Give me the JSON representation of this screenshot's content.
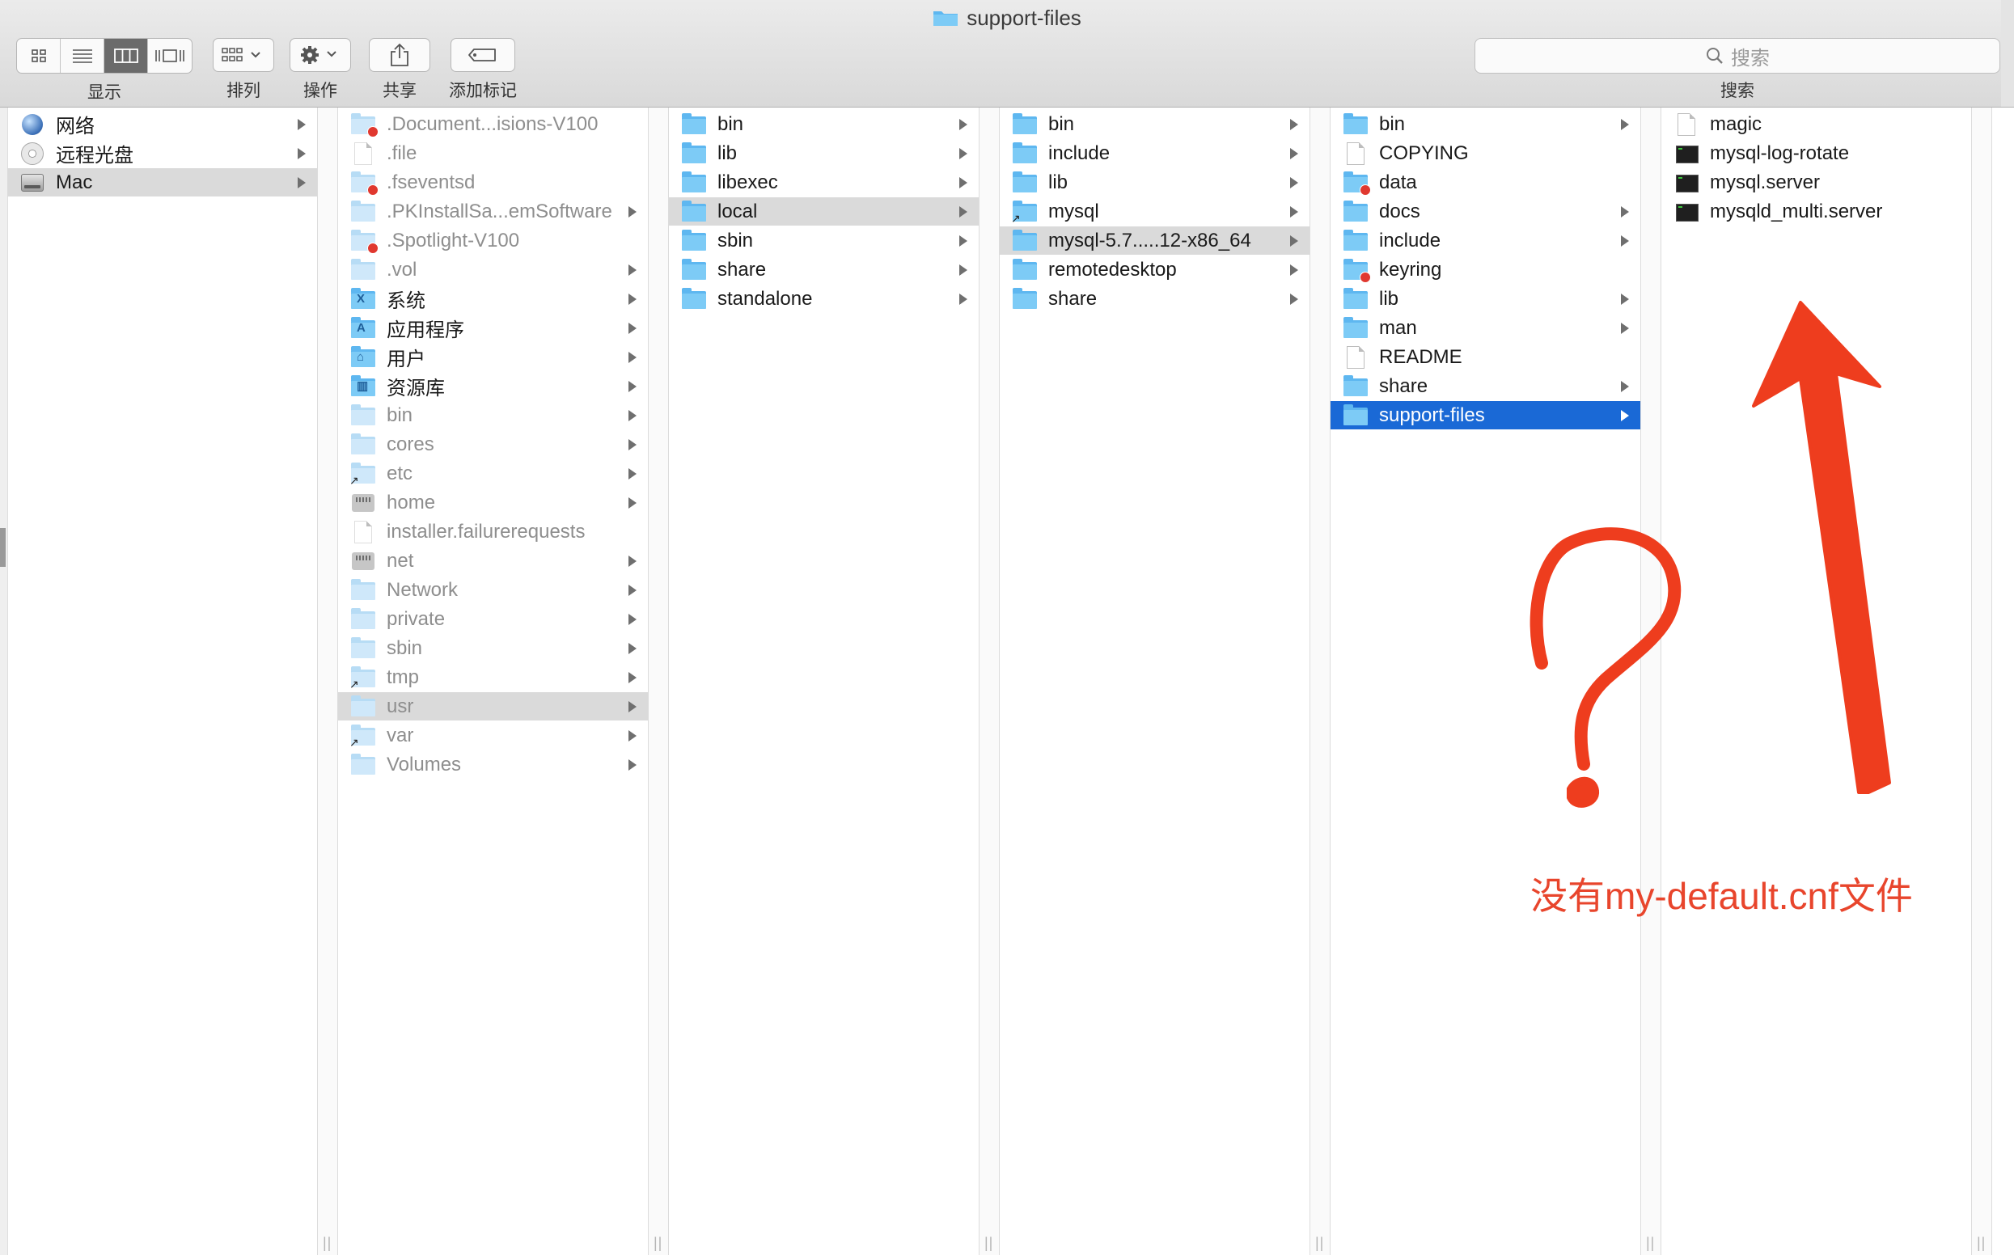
{
  "window": {
    "title": "support-files"
  },
  "toolbar": {
    "view_label": "显示",
    "arrange_label": "排列",
    "action_label": "操作",
    "share_label": "共享",
    "tags_label": "添加标记",
    "search_placeholder": "搜索",
    "search_label": "搜索"
  },
  "columns": [
    {
      "items": [
        {
          "label": "网络",
          "icon": "globe-icon",
          "arrow": true
        },
        {
          "label": "远程光盘",
          "icon": "disc-icon",
          "arrow": true
        },
        {
          "label": "Mac",
          "icon": "hard-drive-icon",
          "arrow": true,
          "state": "path"
        }
      ]
    },
    {
      "items": [
        {
          "label": ".Document...isions-V100",
          "icon": "folder-icon",
          "dim": true,
          "badge": "restricted"
        },
        {
          "label": ".file",
          "icon": "document-icon",
          "dim": true
        },
        {
          "label": ".fseventsd",
          "icon": "folder-icon",
          "dim": true,
          "badge": "restricted"
        },
        {
          "label": ".PKInstallSa...emSoftware",
          "icon": "folder-icon",
          "dim": true,
          "arrow": true
        },
        {
          "label": ".Spotlight-V100",
          "icon": "folder-icon",
          "dim": true,
          "badge": "restricted"
        },
        {
          "label": ".vol",
          "icon": "folder-icon",
          "dim": true,
          "arrow": true
        },
        {
          "label": "系统",
          "icon": "system-folder-icon",
          "arrow": true,
          "glyph": "X"
        },
        {
          "label": "应用程序",
          "icon": "applications-folder-icon",
          "arrow": true,
          "glyph": "A"
        },
        {
          "label": "用户",
          "icon": "users-folder-icon",
          "arrow": true,
          "glyph": "⌂"
        },
        {
          "label": "资源库",
          "icon": "library-folder-icon",
          "arrow": true,
          "glyph": "▥"
        },
        {
          "label": "bin",
          "icon": "folder-icon",
          "dim": true,
          "arrow": true
        },
        {
          "label": "cores",
          "icon": "folder-icon",
          "dim": true,
          "arrow": true
        },
        {
          "label": "etc",
          "icon": "folder-icon",
          "dim": true,
          "arrow": true,
          "badge": "alias"
        },
        {
          "label": "home",
          "icon": "network-folder-icon",
          "dim": true,
          "arrow": true
        },
        {
          "label": "installer.failurerequests",
          "icon": "document-icon",
          "dim": true
        },
        {
          "label": "net",
          "icon": "network-folder-icon",
          "dim": true,
          "arrow": true
        },
        {
          "label": "Network",
          "icon": "folder-icon",
          "dim": true,
          "arrow": true
        },
        {
          "label": "private",
          "icon": "folder-icon",
          "dim": true,
          "arrow": true
        },
        {
          "label": "sbin",
          "icon": "folder-icon",
          "dim": true,
          "arrow": true
        },
        {
          "label": "tmp",
          "icon": "folder-icon",
          "dim": true,
          "arrow": true,
          "badge": "alias"
        },
        {
          "label": "usr",
          "icon": "folder-icon",
          "dim": true,
          "arrow": true,
          "state": "path"
        },
        {
          "label": "var",
          "icon": "folder-icon",
          "dim": true,
          "arrow": true,
          "badge": "alias"
        },
        {
          "label": "Volumes",
          "icon": "folder-icon",
          "dim": true,
          "arrow": true
        }
      ]
    },
    {
      "items": [
        {
          "label": "bin",
          "icon": "folder-icon",
          "arrow": true
        },
        {
          "label": "lib",
          "icon": "folder-icon",
          "arrow": true
        },
        {
          "label": "libexec",
          "icon": "folder-icon",
          "arrow": true
        },
        {
          "label": "local",
          "icon": "folder-icon",
          "arrow": true,
          "state": "path"
        },
        {
          "label": "sbin",
          "icon": "folder-icon",
          "arrow": true
        },
        {
          "label": "share",
          "icon": "folder-icon",
          "arrow": true
        },
        {
          "label": "standalone",
          "icon": "folder-icon",
          "arrow": true
        }
      ]
    },
    {
      "items": [
        {
          "label": "bin",
          "icon": "folder-icon",
          "arrow": true
        },
        {
          "label": "include",
          "icon": "folder-icon",
          "arrow": true
        },
        {
          "label": "lib",
          "icon": "folder-icon",
          "arrow": true
        },
        {
          "label": "mysql",
          "icon": "folder-icon",
          "arrow": true,
          "badge": "alias"
        },
        {
          "label": "mysql-5.7.....12-x86_64",
          "icon": "folder-icon",
          "arrow": true,
          "state": "path"
        },
        {
          "label": "remotedesktop",
          "icon": "folder-icon",
          "arrow": true
        },
        {
          "label": "share",
          "icon": "folder-icon",
          "arrow": true
        }
      ]
    },
    {
      "items": [
        {
          "label": "bin",
          "icon": "folder-icon",
          "arrow": true
        },
        {
          "label": "COPYING",
          "icon": "document-icon"
        },
        {
          "label": "data",
          "icon": "folder-icon",
          "badge": "restricted"
        },
        {
          "label": "docs",
          "icon": "folder-icon",
          "arrow": true
        },
        {
          "label": "include",
          "icon": "folder-icon",
          "arrow": true
        },
        {
          "label": "keyring",
          "icon": "folder-icon",
          "badge": "restricted"
        },
        {
          "label": "lib",
          "icon": "folder-icon",
          "arrow": true
        },
        {
          "label": "man",
          "icon": "folder-icon",
          "arrow": true
        },
        {
          "label": "README",
          "icon": "document-icon"
        },
        {
          "label": "share",
          "icon": "folder-icon",
          "arrow": true
        },
        {
          "label": "support-files",
          "icon": "folder-icon",
          "arrow": true,
          "state": "selected"
        }
      ]
    },
    {
      "items": [
        {
          "label": "magic",
          "icon": "document-icon"
        },
        {
          "label": "mysql-log-rotate",
          "icon": "executable-icon"
        },
        {
          "label": "mysql.server",
          "icon": "executable-icon"
        },
        {
          "label": "mysqld_multi.server",
          "icon": "executable-icon"
        }
      ]
    }
  ],
  "annotation": {
    "question_mark": "?",
    "text": "没有my-default.cnf文件",
    "color": "#e8452c"
  },
  "colors": {
    "selection": "#1a69d6",
    "path_highlight": "#dadada",
    "folder": "#5eb7f0"
  }
}
